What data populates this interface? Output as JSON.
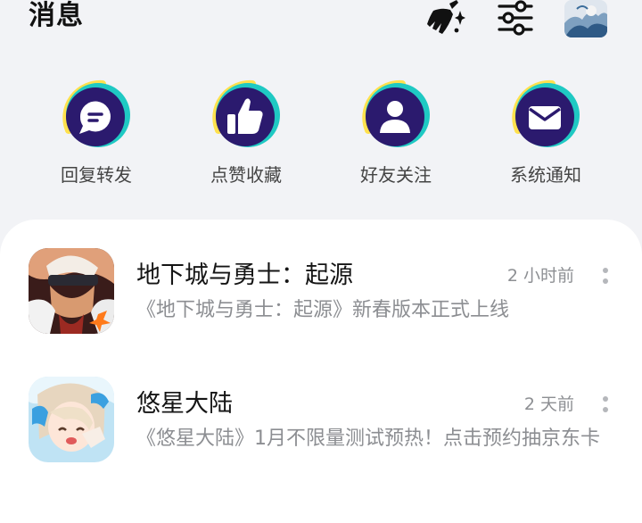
{
  "header": {
    "title": "消息",
    "icons": [
      "broom-sparkle-icon",
      "filter-sliders-icon",
      "user-avatar"
    ]
  },
  "categories": [
    {
      "label": "回复转发",
      "icon": "chat-bubble-icon"
    },
    {
      "label": "点赞收藏",
      "icon": "thumbs-up-icon"
    },
    {
      "label": "好友关注",
      "icon": "person-icon"
    },
    {
      "label": "系统通知",
      "icon": "envelope-icon"
    }
  ],
  "messages": [
    {
      "name": "地下城与勇士：起源",
      "time": "2 小时前",
      "preview": "《地下城与勇士：起源》新春版本正式上线"
    },
    {
      "name": "悠星大陆",
      "time": "2 天前",
      "preview": "《悠星大陆》1月不限量测试预热！点击预约抽京东卡"
    }
  ],
  "colors": {
    "badge_dark": "#2b1a6e",
    "badge_teal": "#1fc9c3",
    "badge_yellow": "#ffe14d",
    "background": "#f2f3f6"
  }
}
